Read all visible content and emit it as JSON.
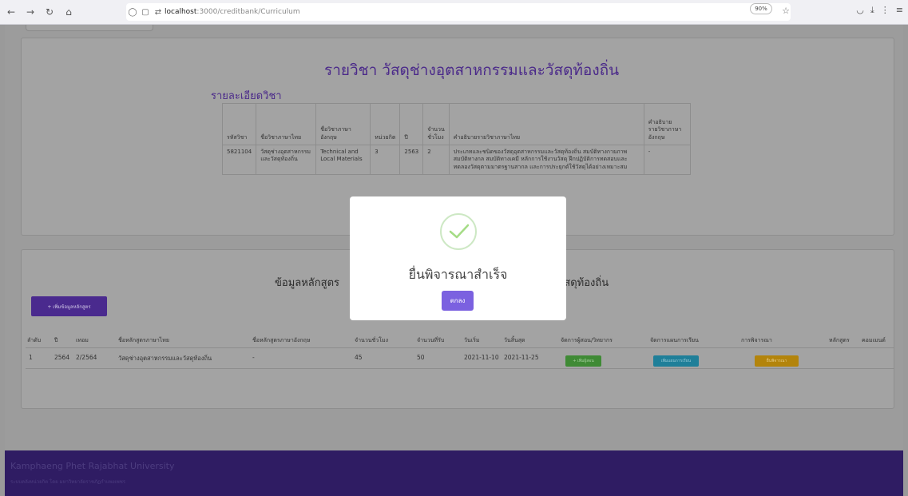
{
  "browser": {
    "url_host": "localhost",
    "url_path": ":3000/creditbank/Curriculum",
    "zoom": "90%"
  },
  "page": {
    "subject_title": "รายวิชา วัสดุช่างอุตสาหกรรมและวัสดุท้องถิ่น",
    "detail_title": "รายละเอียดวิชา",
    "detail_table": {
      "headers": [
        "รหัสวิชา",
        "ชื่อวิชาภาษาไทย",
        "ชื่อวิชาภาษาอังกฤษ",
        "หน่วยกิต",
        "ปี",
        "จำนวนชั่วโมง",
        "คำอธิบายรายวิชาภาษาไทย",
        "คำอธิบายรายวิชาภาษาอังกฤษ"
      ],
      "row": {
        "code": "5821104",
        "name_th": "วัสดุช่างอุตสาหกรรมและวัสดุท้องถิ่น",
        "name_en": "Technical and Local Materials",
        "credit": "3",
        "year": "2563",
        "hours": "2",
        "desc_th": "ประเภทและชนิดของวัสดุอุตสาหกรรมและวัสดุท้องถิ่น สมบัติทางกายภาพ สมบัติทางกล สมบัติทางเคมี หลักการใช้งานวัสดุ ฝึกปฏิบัติการทดสอบและทดลองวัสดุตามมาตรฐานสากล และการประยุกต์ใช้วัสดุได้อย่างเหมาะสม",
        "desc_en": "-"
      }
    },
    "course_title_left": "ข้อมูลหลักสูตร",
    "course_title_right": "วัสดุท้องถิ่น",
    "add_course_label": "+ เพิ่มข้อมูลหลักสูตร",
    "course_table": {
      "headers": [
        "ลำดับ",
        "ปี",
        "เทอม",
        "ชื่อหลักสูตรภาษาไทย",
        "ชื่อหลักสูตรภาษาอังกฤษ",
        "จำนวนชั่วโมง",
        "จำนวนที่รับ",
        "วันเริ่ม",
        "วันสิ้นสุด",
        "จัดการผู้สอน/วิทยากร",
        "จัดการแผนการเรียน",
        "การพิจารณา",
        "หลักสูตร",
        "คอมเมนต์"
      ],
      "row": {
        "no": "1",
        "year": "2564",
        "term": "2/2564",
        "name_th": "วัสดุช่างอุตสาหกรรมและวัสดุท้องถิ่น",
        "name_en": "-",
        "hours": "45",
        "seats": "50",
        "start": "2021-11-10",
        "end": "2021-11-25",
        "btn_teacher": "+ เพิ่มผู้สอน",
        "btn_plan": "เพิ่มแผนการเรียน",
        "btn_review": "ยื่นพิจารณา"
      }
    },
    "footer": {
      "name": "Kamphaeng Phet Rajabhat University",
      "sub": "ระบบคลังหน่วยกิต โดย มหาวิทยาลัยราชภัฏกำแพงเพชร"
    }
  },
  "modal": {
    "title": "ยื่นพิจารณาสำเร็จ",
    "ok_label": "ตกลง"
  },
  "colors": {
    "accent": "#7b61e0",
    "footer": "#2f1c63",
    "success": "#a5dc86"
  }
}
